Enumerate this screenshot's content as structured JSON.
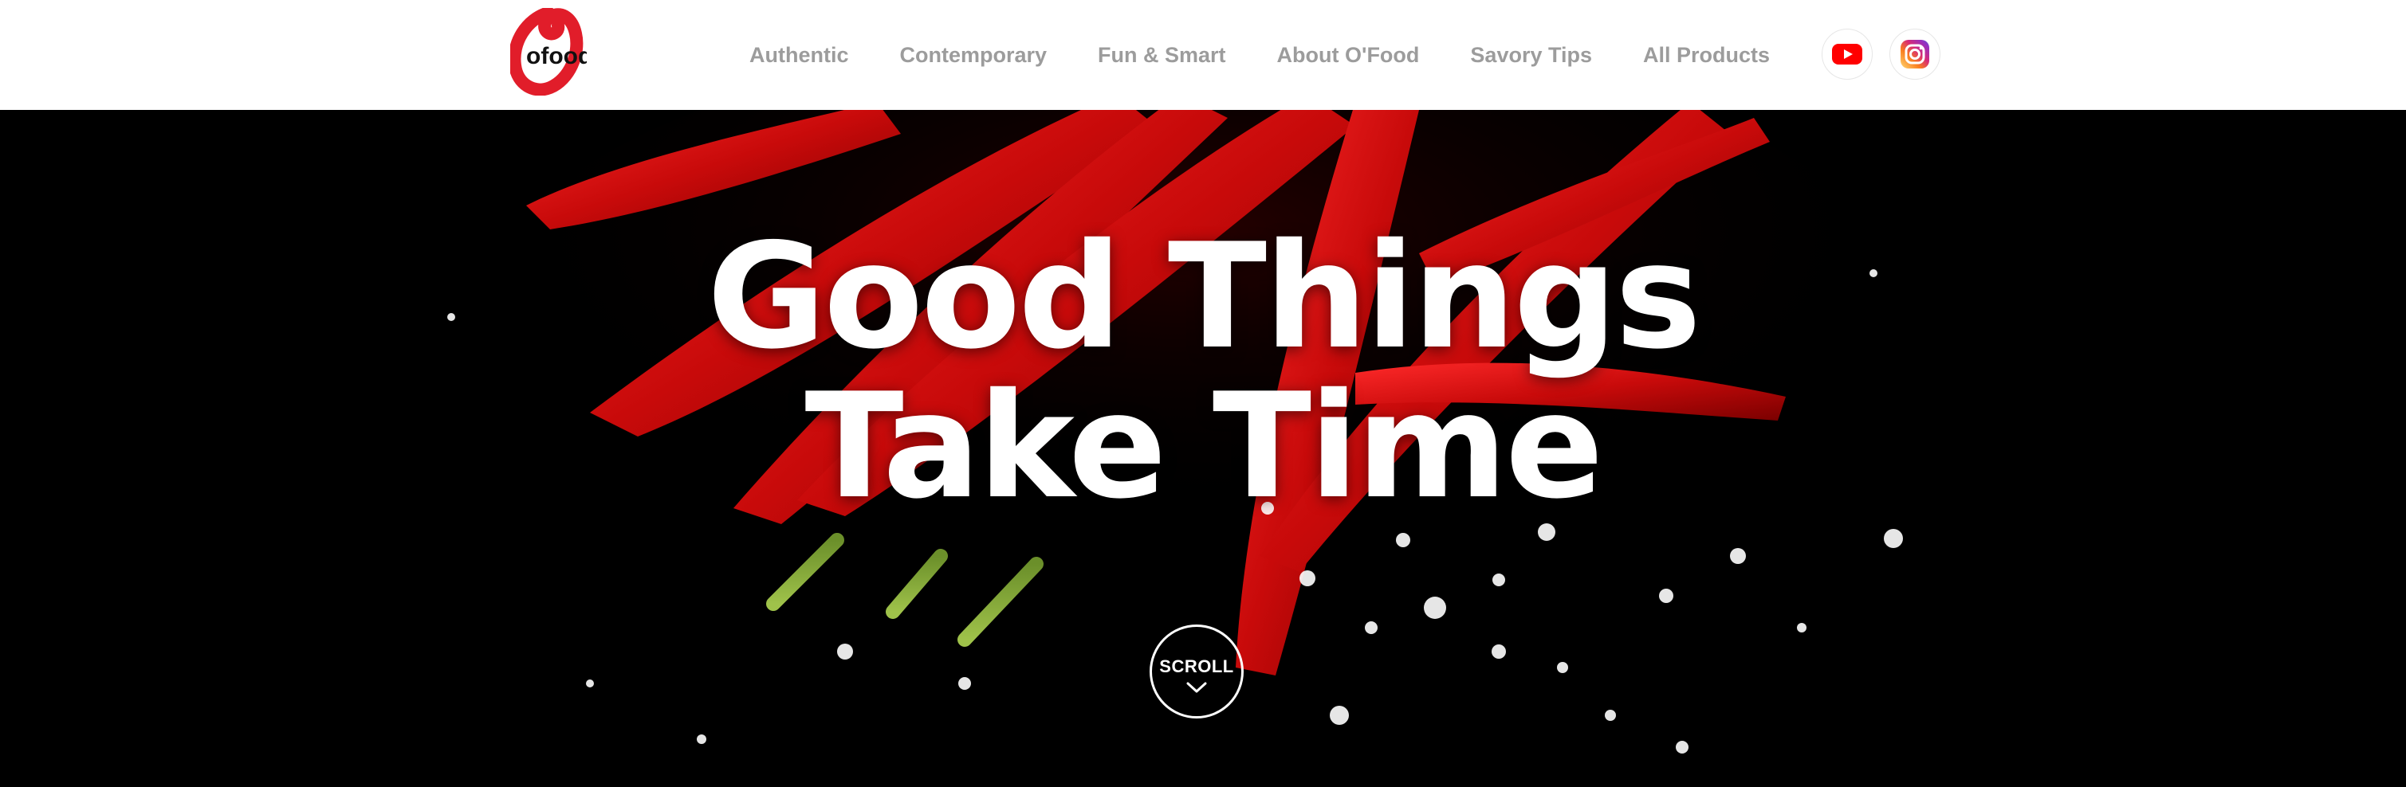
{
  "brand": {
    "logo_text": "ofood",
    "accent": "#e11d2a"
  },
  "nav": {
    "items": [
      {
        "label": "Authentic"
      },
      {
        "label": "Contemporary"
      },
      {
        "label": "Fun & Smart"
      },
      {
        "label": "About O'Food"
      },
      {
        "label": "Savory Tips"
      },
      {
        "label": "All Products"
      }
    ]
  },
  "social": [
    {
      "icon": "youtube-icon",
      "color": "#ff0000"
    },
    {
      "icon": "instagram-icon",
      "color": "#c13584"
    }
  ],
  "hero": {
    "headline_line1": "Good Things",
    "headline_line2": "Take Time",
    "scroll_label": "SCROLL"
  }
}
